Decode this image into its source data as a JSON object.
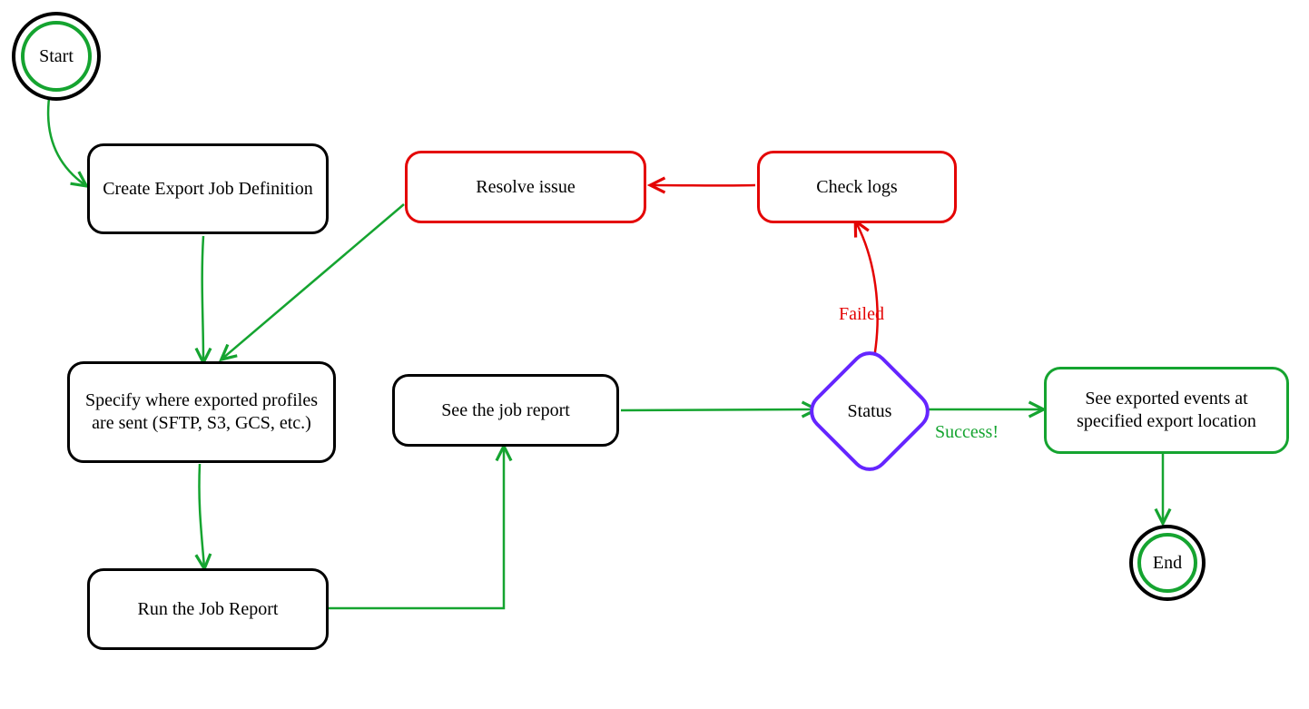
{
  "chart_data": {
    "type": "flowchart",
    "nodes": [
      {
        "id": "start",
        "kind": "terminator",
        "label": "Start"
      },
      {
        "id": "create",
        "kind": "process",
        "label": "Create Export Job Definition"
      },
      {
        "id": "specify",
        "kind": "process",
        "label": "Specify where exported profiles are sent (SFTP, S3, GCS, etc.)"
      },
      {
        "id": "run",
        "kind": "process",
        "label": "Run the Job Report"
      },
      {
        "id": "see_report",
        "kind": "process",
        "label": "See the job report"
      },
      {
        "id": "status",
        "kind": "decision",
        "label": "Status"
      },
      {
        "id": "check_logs",
        "kind": "process",
        "label": "Check logs",
        "accent": "error"
      },
      {
        "id": "resolve",
        "kind": "process",
        "label": "Resolve issue",
        "accent": "error"
      },
      {
        "id": "see_exported",
        "kind": "process",
        "label": "See exported events at specified export location",
        "accent": "success"
      },
      {
        "id": "end",
        "kind": "terminator",
        "label": "End"
      }
    ],
    "edges": [
      {
        "from": "start",
        "to": "create",
        "color": "green"
      },
      {
        "from": "create",
        "to": "specify",
        "color": "green"
      },
      {
        "from": "resolve",
        "to": "specify",
        "color": "green"
      },
      {
        "from": "specify",
        "to": "run",
        "color": "green"
      },
      {
        "from": "run",
        "to": "see_report",
        "color": "green"
      },
      {
        "from": "see_report",
        "to": "status",
        "color": "green"
      },
      {
        "from": "status",
        "to": "check_logs",
        "label": "Failed",
        "color": "red"
      },
      {
        "from": "check_logs",
        "to": "resolve",
        "color": "red"
      },
      {
        "from": "status",
        "to": "see_exported",
        "label": "Success!",
        "color": "green"
      },
      {
        "from": "see_exported",
        "to": "end",
        "color": "green"
      }
    ]
  },
  "labels": {
    "start": "Start",
    "end": "End",
    "create": "Create Export Job Definition",
    "specify": "Specify where exported profiles are sent (SFTP, S3, GCS, etc.)",
    "run": "Run the Job Report",
    "see_report": "See the job report",
    "status": "Status",
    "check_logs": "Check logs",
    "resolve": "Resolve issue",
    "see_exported": "See exported events at specified export location",
    "failed": "Failed",
    "success": "Success!"
  },
  "palette": {
    "flow": "#15a430",
    "error": "#e40303",
    "decision": "#6525ff",
    "default": "#000000"
  }
}
